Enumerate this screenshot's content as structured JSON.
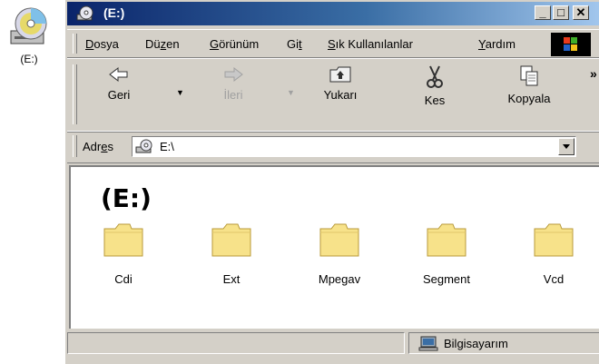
{
  "desktop": {
    "icon_label": "(E:)"
  },
  "window": {
    "title": "(E:)",
    "buttons": {
      "minimize": "_",
      "maximize": "□",
      "close": "✕"
    }
  },
  "menubar": {
    "items": [
      {
        "pre": "",
        "accel": "D",
        "post": "osya"
      },
      {
        "pre": "Dü",
        "accel": "z",
        "post": "en"
      },
      {
        "pre": "",
        "accel": "G",
        "post": "örünüm"
      },
      {
        "pre": "Gi",
        "accel": "t",
        "post": ""
      },
      {
        "pre": "",
        "accel": "S",
        "post": "ık Kullanılanlar"
      },
      {
        "pre": "",
        "accel": "Y",
        "post": "ardım"
      }
    ]
  },
  "toolbar": {
    "back_label": "Geri",
    "forward_label": "İleri",
    "up_label": "Yukarı",
    "cut_label": "Kes",
    "copy_label": "Kopyala",
    "overflow": "»"
  },
  "addressbar": {
    "label_pre": "Adr",
    "label_accel": "e",
    "label_post": "s",
    "value": "E:\\"
  },
  "content": {
    "title": "(E:)",
    "folders": [
      "Cdi",
      "Ext",
      "Mpegav",
      "Segment",
      "Vcd"
    ]
  },
  "statusbar": {
    "zone_text": "Bilgisayarım"
  },
  "colors": {
    "titlebar_start": "#0a246a",
    "titlebar_end": "#a6caf0",
    "folder": "#f7e28a",
    "face": "#d4d0c8"
  }
}
